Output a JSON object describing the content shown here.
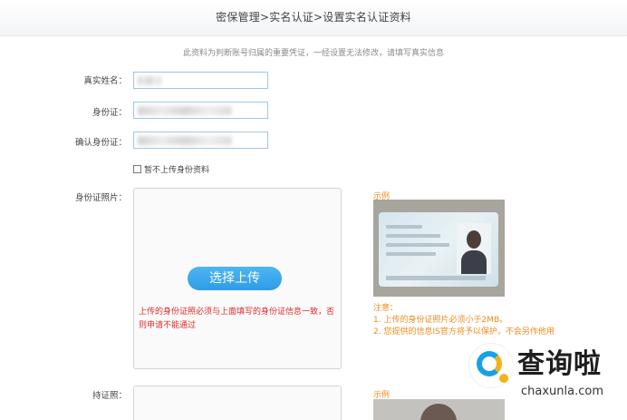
{
  "header": {
    "breadcrumb": "密保管理>实名认证>设置实名认证资料"
  },
  "notice": "此资料为判断账号归属的重要凭证，一经设置无法修改，请填写真实信息",
  "form": {
    "real_name_label": "真实姓名：",
    "id_number_label": "身份证：",
    "confirm_id_label": "确认身份证：",
    "skip_upload_label": "暂不上传身份资料",
    "id_photo_label": "身份证照片：",
    "holding_photo_label": "持证照："
  },
  "upload": {
    "button_label": "选择上传",
    "warning": "上传的身份证照必须与上面填写的身份证信息一致，否则申请不能通过"
  },
  "sample": {
    "label": "示例",
    "label2": "示例",
    "note_title": "注意：",
    "note_1": "1. 上传的身份证照片必须小于2MB。",
    "note_2": "2. 您提供的信息IS官方将予以保护，不会另作他用"
  },
  "watermark": {
    "name": "查询啦",
    "domain": "chaxunla.com"
  },
  "colors": {
    "accent_blue": "#2f9ce6",
    "warning_red": "#e02b2b",
    "note_orange": "#f08a1c",
    "input_border": "#9ec6e6"
  }
}
